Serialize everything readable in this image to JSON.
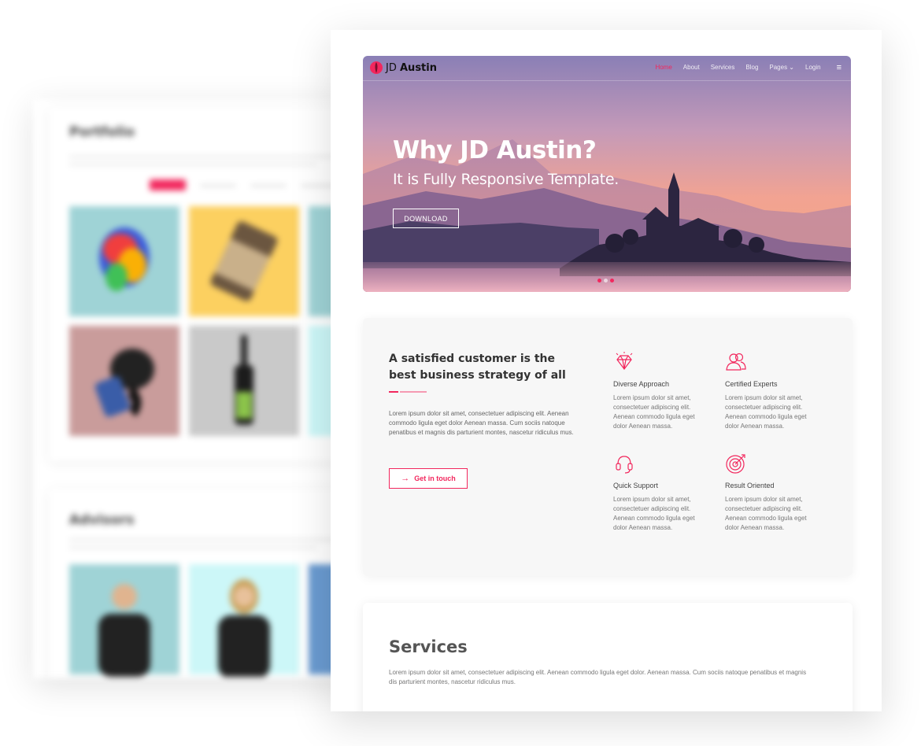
{
  "back_page": {
    "portfolio_title": "Portfolio",
    "advisors_title": "Advisors"
  },
  "navbar": {
    "logo_prefix": "JD",
    "logo_name": "Austin",
    "items": [
      {
        "label": "Home"
      },
      {
        "label": "About"
      },
      {
        "label": "Services"
      },
      {
        "label": "Blog"
      },
      {
        "label": "Pages ⌄"
      },
      {
        "label": "Login"
      }
    ]
  },
  "hero": {
    "title": "Why JD Austin?",
    "subtitle": "It is Fully Responsive Template.",
    "button_label": "DOWNLOAD"
  },
  "about": {
    "title": "A satisfied customer is the best business strategy of all",
    "text": "Lorem ipsum dolor sit amet, consectetuer adipiscing elit. Aenean commodo ligula eget dolor Aenean massa. Cum sociis natoque penatibus et magnis dis parturient montes, nascetur ridiculus mus.",
    "button_label": "Get in touch",
    "features": [
      {
        "name": "Diverse Approach",
        "icon": "diamond-icon",
        "desc": "Lorem ipsum dolor sit amet, consectetuer adipiscing elit. Aenean commodo ligula eget dolor Aenean massa."
      },
      {
        "name": "Certified Experts",
        "icon": "users-icon",
        "desc": "Lorem ipsum dolor sit amet, consectetuer adipiscing elit. Aenean commodo ligula eget dolor Aenean massa."
      },
      {
        "name": "Quick Support",
        "icon": "headset-icon",
        "desc": "Lorem ipsum dolor sit amet, consectetuer adipiscing elit. Aenean commodo ligula eget dolor Aenean massa."
      },
      {
        "name": "Result Oriented",
        "icon": "target-icon",
        "desc": "Lorem ipsum dolor sit amet, consectetuer adipiscing elit. Aenean commodo ligula eget dolor Aenean massa."
      }
    ]
  },
  "services": {
    "title": "Services",
    "text": "Lorem ipsum dolor sit amet, consectetuer adipiscing elit. Aenean commodo ligula eget dolor. Aenean massa. Cum sociis natoque penatibus et magnis dis parturient montes, nascetur ridiculus mus."
  },
  "colors": {
    "accent": "#f2275d",
    "hero_sky_top": "#8a7fb6",
    "hero_sky_bottom": "#f6a67d"
  }
}
